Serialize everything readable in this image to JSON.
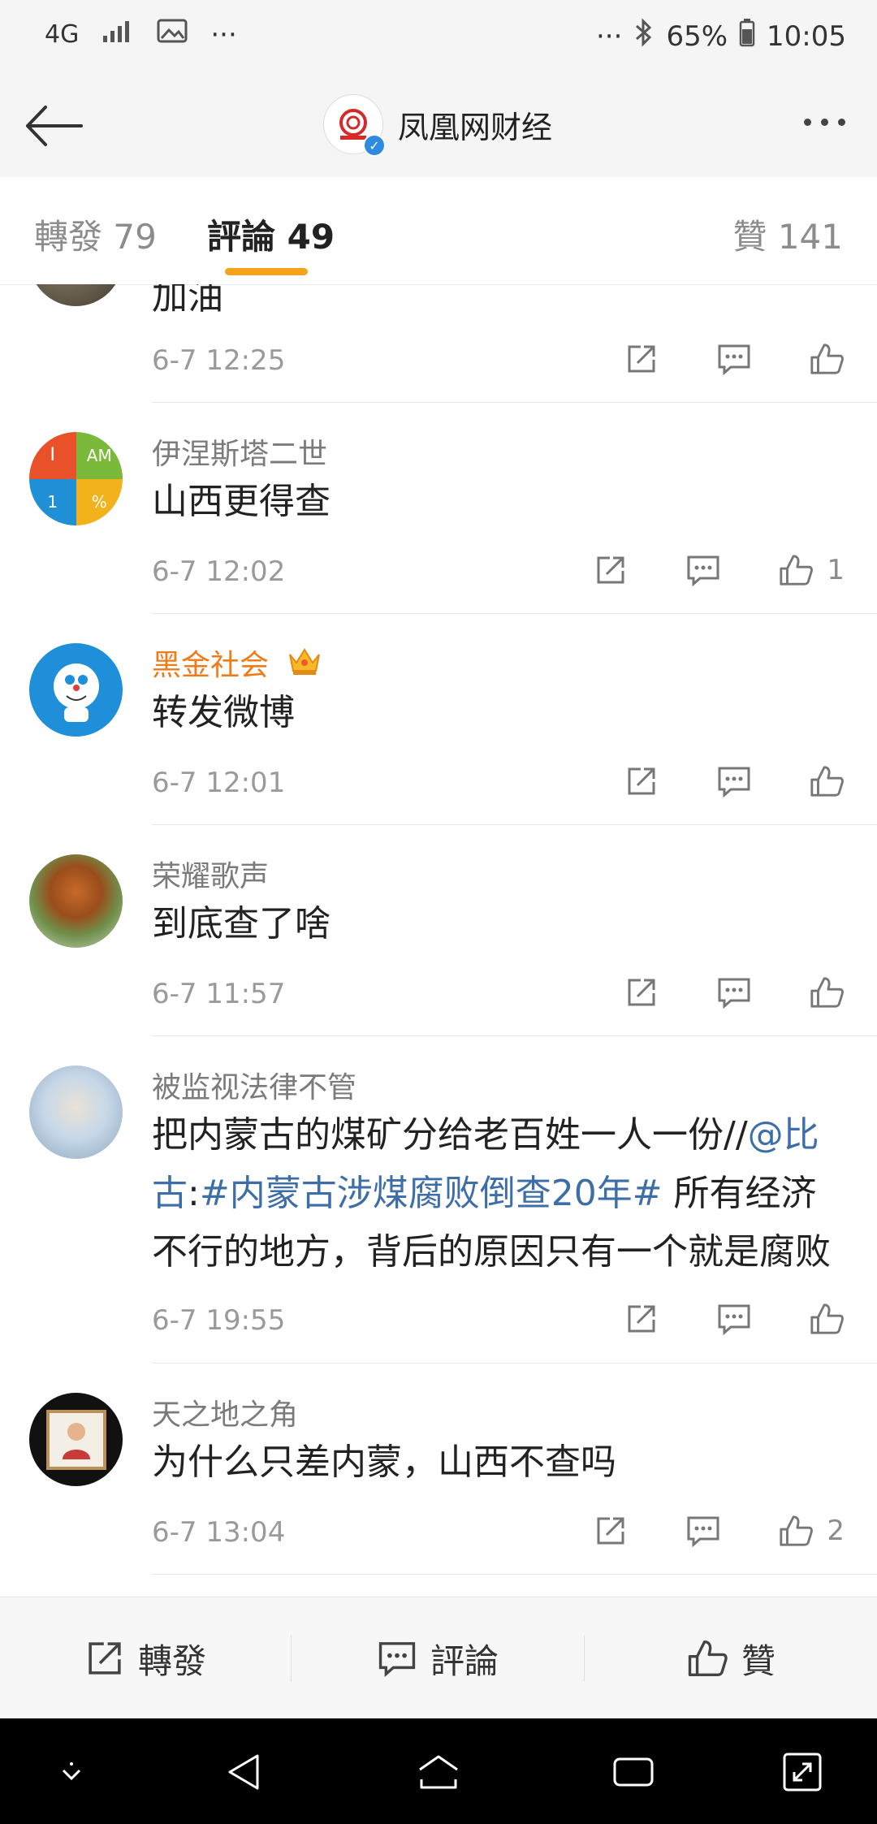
{
  "status_bar": {
    "network": "4G",
    "more_left": "···",
    "more_right": "···",
    "battery": "65%",
    "time": "10:05"
  },
  "header": {
    "back_icon": "arrow-left-icon",
    "account_name": "凤凰网财经",
    "verified_icon": "verified-badge-icon",
    "more_icon": "more-dots-icon"
  },
  "tabs": {
    "repost": "轉發 79",
    "comments": "評論 49",
    "likes": "贊 141",
    "active_color": "#f7a21b"
  },
  "comments": [
    {
      "name": "",
      "text": "加油",
      "time": "6-7 12:25",
      "likes": ""
    },
    {
      "name": "伊涅斯塔二世",
      "text": "山西更得查",
      "time": "6-7 12:02",
      "likes": "1"
    },
    {
      "name": "黑金社会",
      "text": "转发微博",
      "time": "6-7 12:01",
      "likes": ""
    },
    {
      "name": "荣耀歌声",
      "text": "到底查了啥",
      "time": "6-7 11:57",
      "likes": ""
    },
    {
      "name": "被监视法律不管",
      "text_part1": "把内蒙古的煤矿分给老百姓一人一份//",
      "mention": "@比古",
      "colon": ":",
      "hashtag": "#内蒙古涉煤腐败倒查20年#",
      "text_part2": " 所有经济不行的地方，背后的原因只有一个就是腐败",
      "time": "6-7 19:55",
      "likes": ""
    },
    {
      "name": "天之地之角",
      "text": "为什么只差内蒙，山西不查吗",
      "time": "6-7 13:04",
      "likes": "2"
    }
  ],
  "avatar_text": {
    "i": "I",
    "am": "AM",
    "one": "1",
    "pct": "%"
  },
  "bottom_bar": {
    "repost": "轉發",
    "comment": "評論",
    "like": "贊"
  },
  "colors": {
    "vip_name": "#ee7c1b",
    "link": "#3e6ea8",
    "accent": "#f7a21b"
  }
}
